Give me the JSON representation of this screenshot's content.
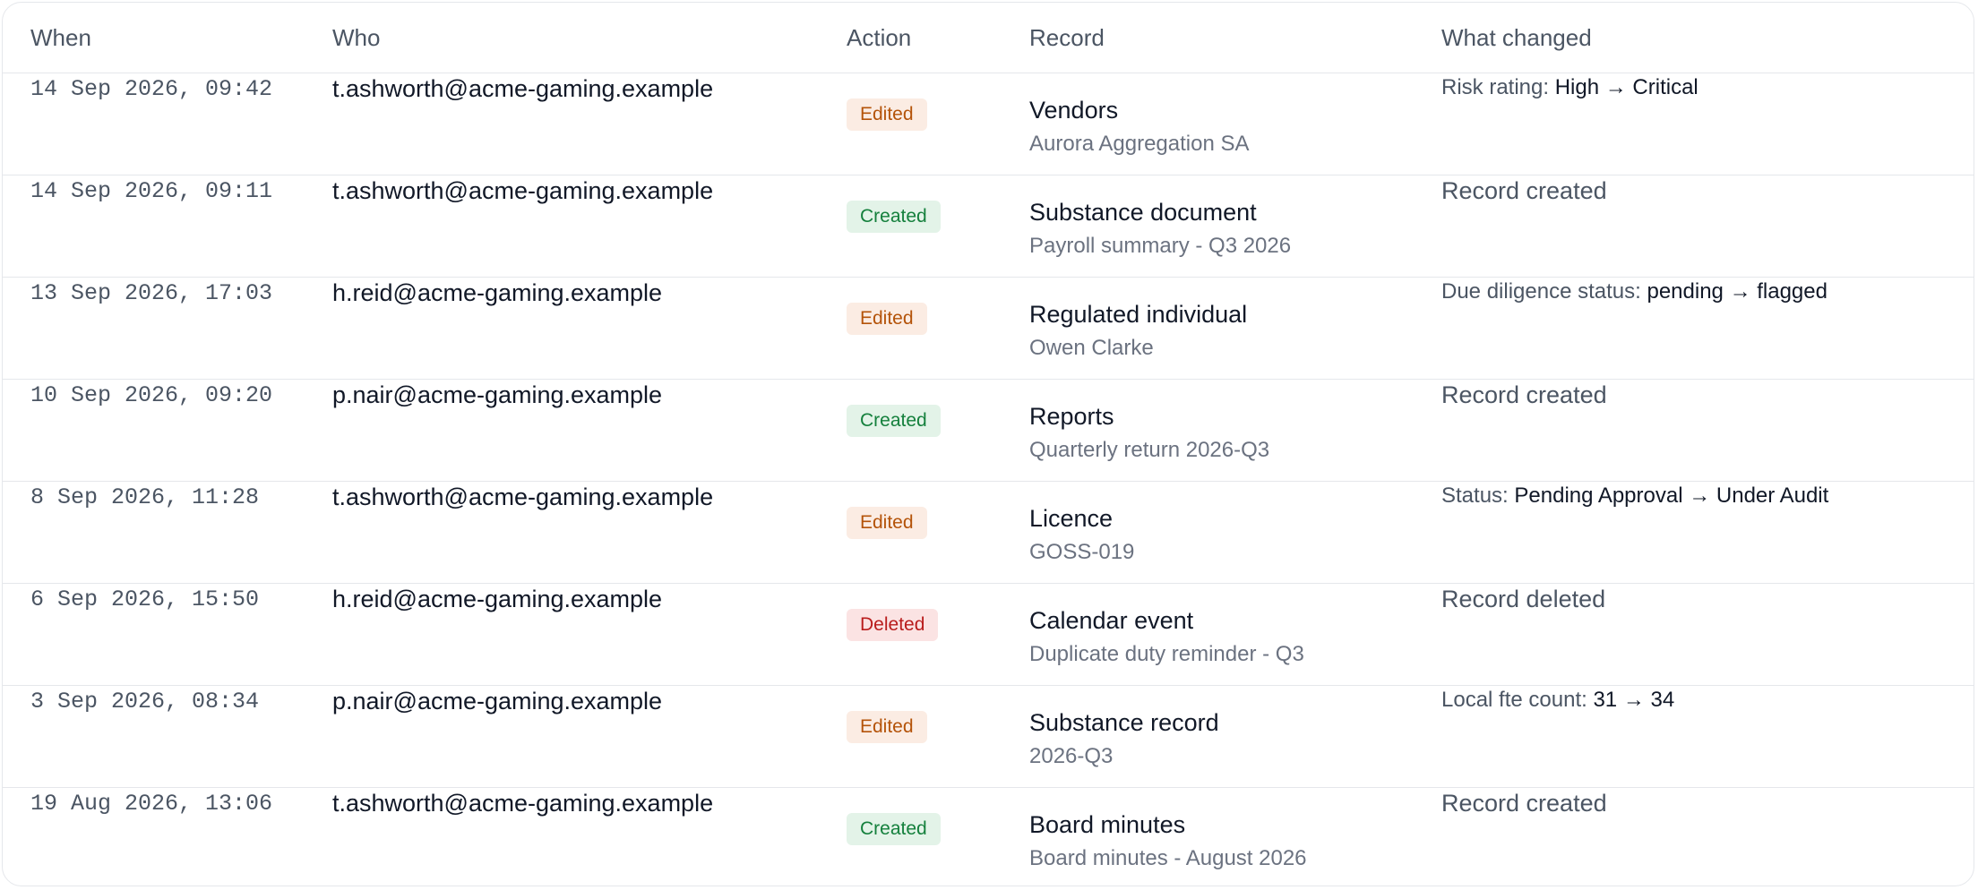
{
  "columns": {
    "when": "When",
    "who": "Who",
    "action": "Action",
    "record": "Record",
    "changed": "What changed"
  },
  "rows": [
    {
      "when": "14 Sep 2026, 09:42",
      "who": "t.ashworth@acme-gaming.example",
      "action": "Edited",
      "action_type": "edited",
      "record_type": "Vendors",
      "record_name": "Aurora Aggregation SA",
      "change": {
        "field": "Risk rating:",
        "from": "High",
        "arrow": "→",
        "to": "Critical"
      }
    },
    {
      "when": "14 Sep 2026, 09:11",
      "who": "t.ashworth@acme-gaming.example",
      "action": "Created",
      "action_type": "created",
      "record_type": "Substance document",
      "record_name": "Payroll summary - Q3 2026",
      "change_text": "Record created"
    },
    {
      "when": "13 Sep 2026, 17:03",
      "who": "h.reid@acme-gaming.example",
      "action": "Edited",
      "action_type": "edited",
      "record_type": "Regulated individual",
      "record_name": "Owen Clarke",
      "change": {
        "field": "Due diligence status:",
        "from": "pending",
        "arrow": "→",
        "to": "flagged"
      }
    },
    {
      "when": "10 Sep 2026, 09:20",
      "who": "p.nair@acme-gaming.example",
      "action": "Created",
      "action_type": "created",
      "record_type": "Reports",
      "record_name": "Quarterly return 2026-Q3",
      "change_text": "Record created"
    },
    {
      "when": "8 Sep 2026, 11:28",
      "who": "t.ashworth@acme-gaming.example",
      "action": "Edited",
      "action_type": "edited",
      "record_type": "Licence",
      "record_name": "GOSS-019",
      "change": {
        "field": "Status:",
        "from": "Pending Approval",
        "arrow": "→",
        "to": "Under Audit"
      }
    },
    {
      "when": "6 Sep 2026, 15:50",
      "who": "h.reid@acme-gaming.example",
      "action": "Deleted",
      "action_type": "deleted",
      "record_type": "Calendar event",
      "record_name": "Duplicate duty reminder - Q3",
      "change_text": "Record deleted"
    },
    {
      "when": "3 Sep 2026, 08:34",
      "who": "p.nair@acme-gaming.example",
      "action": "Edited",
      "action_type": "edited",
      "record_type": "Substance record",
      "record_name": "2026-Q3",
      "change": {
        "field": "Local fte count:",
        "from": "31",
        "arrow": "→",
        "to": "34"
      }
    },
    {
      "when": "19 Aug 2026, 13:06",
      "who": "t.ashworth@acme-gaming.example",
      "action": "Created",
      "action_type": "created",
      "record_type": "Board minutes",
      "record_name": "Board minutes - August 2026",
      "change_text": "Record created"
    }
  ],
  "colors": {
    "edited_bg": "#fbece3",
    "edited_fg": "#b45309",
    "created_bg": "#e3f3e8",
    "created_fg": "#15803d",
    "deleted_bg": "#fbe3e3",
    "deleted_fg": "#b91c1c"
  }
}
